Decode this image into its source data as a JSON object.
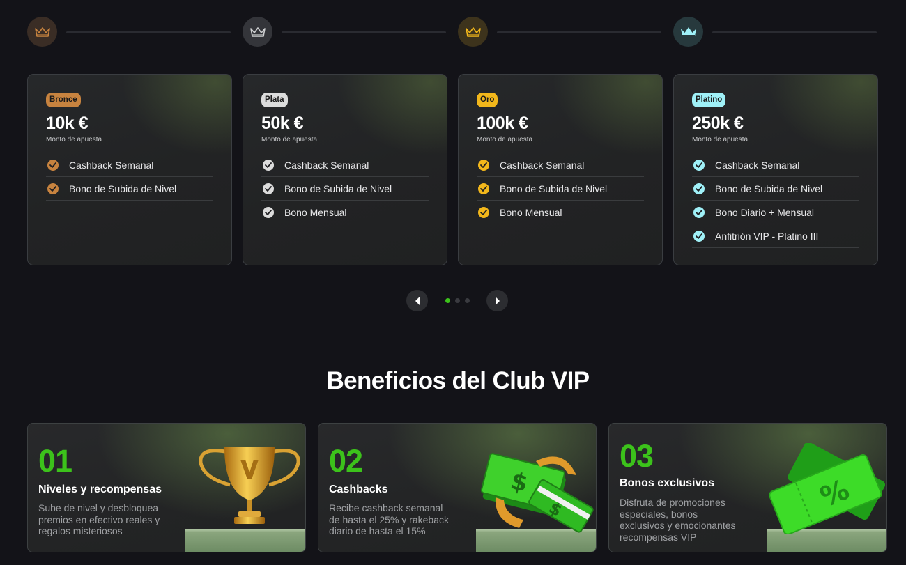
{
  "tiers": [
    {
      "name": "Bronce",
      "amount": "10k €",
      "amount_label": "Monto de apuesta",
      "color": "#c7833f",
      "node_bg": "#3a2d25",
      "crown": "#c7833f",
      "benefits": [
        "Cashback Semanal",
        "Bono de Subida de Nivel"
      ]
    },
    {
      "name": "Plata",
      "amount": "50k €",
      "amount_label": "Monto de apuesta",
      "color": "#dcdcdc",
      "node_bg": "#34353a",
      "crown": "#cfd0d2",
      "benefits": [
        "Cashback Semanal",
        "Bono de Subida de Nivel",
        "Bono Mensual"
      ]
    },
    {
      "name": "Oro",
      "amount": "100k €",
      "amount_label": "Monto de apuesta",
      "color": "#f2b71b",
      "node_bg": "#3d331c",
      "crown": "#f2b71b",
      "benefits": [
        "Cashback Semanal",
        "Bono de Subida de Nivel",
        "Bono Mensual"
      ]
    },
    {
      "name": "Platino",
      "amount": "250k €",
      "amount_label": "Monto de apuesta",
      "color": "#9ff0f7",
      "node_bg": "#27393d",
      "crown": "#9ff0f7",
      "benefits": [
        "Cashback Semanal",
        "Bono de Subida de Nivel",
        "Bono Diario + Mensual",
        "Anfitrión VIP - Platino III"
      ]
    }
  ],
  "carousel": {
    "prev_icon": "chevron-left-icon",
    "next_icon": "chevron-right-icon",
    "active_dot": 0,
    "dot_count": 3,
    "active_color": "#3cc21b",
    "inactive_color": "#3a3b40"
  },
  "benefits_section": {
    "title": "Beneficios del Club VIP",
    "cards": [
      {
        "number": "01",
        "title": "Niveles y recompensas",
        "desc": [
          "Sube de nivel y desbloquea",
          "premios en efectivo reales y",
          "regalos misteriosos"
        ],
        "art": "trophy-icon"
      },
      {
        "number": "02",
        "title": "Cashbacks",
        "desc": [
          "Recibe cashback semanal",
          "de hasta el 25% y rakeback",
          "diario de hasta el 15%"
        ],
        "art": "cash-icon"
      },
      {
        "number": "03",
        "title": "Bonos exclusivos",
        "desc": [
          "Disfruta de promociones",
          "especiales, bonos",
          "exclusivos y emocionantes",
          "recompensas VIP"
        ],
        "art": "ticket-icon"
      }
    ]
  },
  "colors": {
    "background": "#131318",
    "accent": "#3cc21b"
  }
}
